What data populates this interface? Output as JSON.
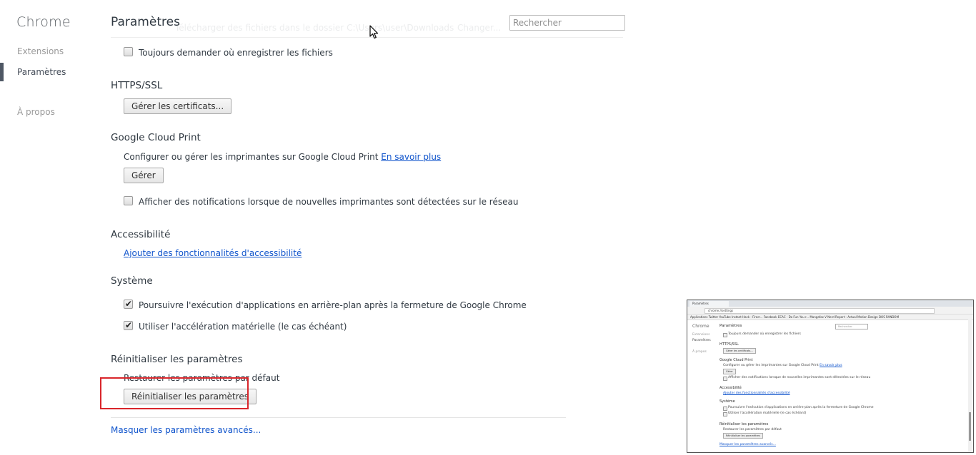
{
  "sidebar": {
    "brand": "Chrome",
    "items": [
      {
        "label": "Extensions",
        "selected": false
      },
      {
        "label": "Paramètres",
        "selected": true
      },
      {
        "label": "À propos",
        "selected": false
      }
    ]
  },
  "header": {
    "title": "Paramètres",
    "search_placeholder": "Rechercher",
    "ghost_text": "Télécharger des fichiers dans le dossier    C:\\Users\\user\\Downloads",
    "ghost_button": "Changer..."
  },
  "downloads": {
    "ask_label": "Toujours demander où enregistrer les fichiers",
    "ask_checked": false
  },
  "https": {
    "title": "HTTPS/SSL",
    "manage_certs_label": "Gérer les certificats..."
  },
  "cloud_print": {
    "title": "Google Cloud Print",
    "description": "Configurer ou gérer les imprimantes sur Google Cloud Print",
    "learn_more": "En savoir plus",
    "manage_label": "Gérer",
    "notify_label": "Afficher des notifications lorsque de nouvelles imprimantes sont détectées sur le réseau",
    "notify_checked": false
  },
  "accessibility": {
    "title": "Accessibilité",
    "add_link": "Ajouter des fonctionnalités d'accessibilité"
  },
  "system": {
    "title": "Système",
    "background_label": "Poursuivre l'exécution d'applications en arrière-plan après la fermeture de Google Chrome",
    "background_checked": true,
    "hw_accel_label": "Utiliser l'accélération matérielle (le cas échéant)",
    "hw_accel_checked": true
  },
  "reset": {
    "title": "Réinitialiser les paramètres",
    "description": "Restaurer les paramètres par défaut",
    "button_label": "Réinitialiser les paramètres"
  },
  "footer": {
    "hide_advanced": "Masquer les paramètres avancés..."
  },
  "thumbnail": {
    "tab_title": "Paramètres",
    "address": "chrome://settings",
    "bookmarks": "Applications   Twitter   YouTube   Instant Hack - Firecr...   Facebook   ECAC - Do Fun You r...   Mangafox   V Nerd Report - Actual   Motion Design   DOS   RANDOM",
    "brand": "Chrome",
    "nav": [
      "Extensions",
      "Paramètres",
      "À propos"
    ],
    "title": "Paramètres",
    "search": "Rechercher",
    "ask": "Toujours demander où enregistrer les fichiers",
    "https": "HTTPS/SSL",
    "certs": "Gérer les certificats...",
    "cloud": "Google Cloud Print",
    "cloud_desc": "Configurer ou gérer les imprimantes sur Google Cloud Print",
    "learn_more": "En savoir plus",
    "manage": "Gérer",
    "notify": "Afficher des notifications lorsque de nouvelles imprimantes sont détectées sur le réseau",
    "a11y": "Accessibilité",
    "a11y_link": "Ajouter des fonctionnalités d'accessibilité",
    "system": "Système",
    "bg": "Poursuivre l'exécution d'applications en arrière-plan après la fermeture de Google Chrome",
    "hw": "Utiliser l'accélération matérielle (le cas échéant)",
    "reset": "Réinitialiser les paramètres",
    "reset_desc": "Restaurer les paramètres par défaut",
    "reset_btn": "Réinitialiser les paramètres",
    "hide": "Masquer les paramètres avancés..."
  },
  "colors": {
    "link": "#1155cc",
    "highlight": "#d9262b",
    "nav_marker": "#4e5764"
  }
}
